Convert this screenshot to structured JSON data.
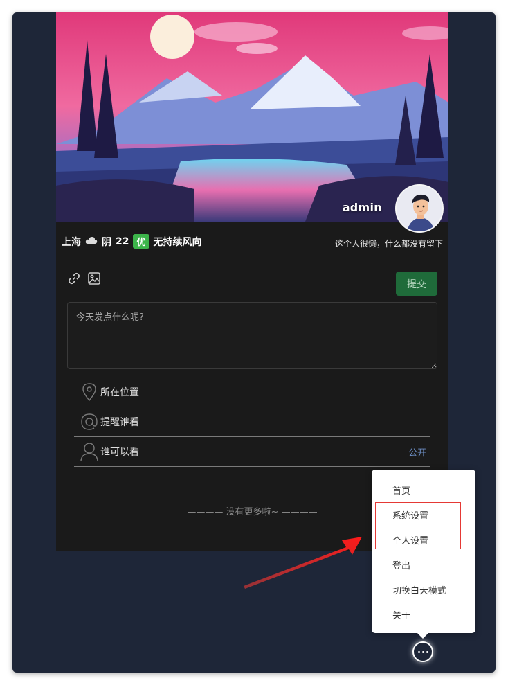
{
  "profile": {
    "username": "admin",
    "bio": "这个人很懒，什么都没有留下"
  },
  "weather": {
    "city": "上海",
    "condition": "阴",
    "temperature": "22",
    "aqi": "优",
    "wind": "无持续风向"
  },
  "composer": {
    "placeholder": "今天发点什么呢?",
    "submit_label": "提交",
    "options": [
      {
        "label": "所在位置",
        "icon": "location-pin-icon",
        "value": ""
      },
      {
        "label": "提醒谁看",
        "icon": "at-icon",
        "value": ""
      },
      {
        "label": "谁可以看",
        "icon": "user-icon",
        "value": "公开"
      }
    ]
  },
  "feed": {
    "end_text": "———— 没有更多啦~ ————"
  },
  "menu": {
    "items": [
      "首页",
      "系统设置",
      "个人设置",
      "登出",
      "切换白天模式",
      "关于"
    ]
  },
  "colors": {
    "page_bg": "#1e2638",
    "card_bg": "#1a1a1a",
    "submit_bg": "#1f6b3a",
    "aqi_green": "#3cb44a",
    "link_blue": "#6d8fc5",
    "annotation_red": "#e53935"
  }
}
